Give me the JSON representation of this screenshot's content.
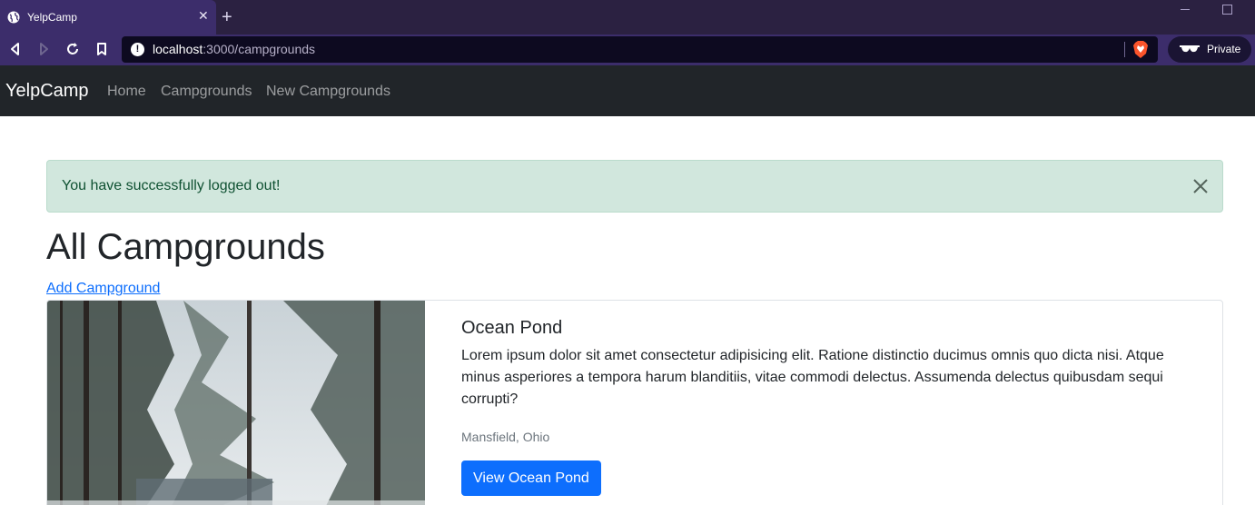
{
  "browser": {
    "tab_title": "YelpCamp",
    "url_host": "localhost",
    "url_path": ":3000/campgrounds",
    "private_label": "Private",
    "icons": {
      "favicon": "globe-icon",
      "close": "close-icon",
      "new_tab": "plus-icon",
      "back": "back-icon",
      "forward": "forward-icon",
      "reload": "reload-icon",
      "bookmark": "bookmark-icon",
      "site_info": "info-icon",
      "shields": "brave-shield-icon",
      "private": "glasses-icon"
    },
    "colors": {
      "tabbar": "#2b2141",
      "toolbar": "#3c2d6b",
      "urlbar": "#0d0a20"
    }
  },
  "navbar": {
    "brand": "YelpCamp",
    "links": [
      "Home",
      "Campgrounds",
      "New Campgrounds"
    ]
  },
  "alert": {
    "message": "You have successfully logged out!",
    "color": "#d1e7dd"
  },
  "main": {
    "title": "All Campgrounds",
    "add_link": "Add Campground"
  },
  "campgrounds": [
    {
      "title": "Ocean Pond",
      "description": "Lorem ipsum dolor sit amet consectetur adipisicing elit. Ratione distinctio ducimus omnis quo dicta nisi. Atque minus asperiores a tempora harum blanditiis, vitae commodi delectus. Assumenda delectus quibusdam sequi corrupti?",
      "location": "Mansfield, Ohio",
      "button_label": "View Ocean Pond"
    }
  ],
  "colors": {
    "primary": "#0d6efd",
    "navbar": "#212529"
  }
}
